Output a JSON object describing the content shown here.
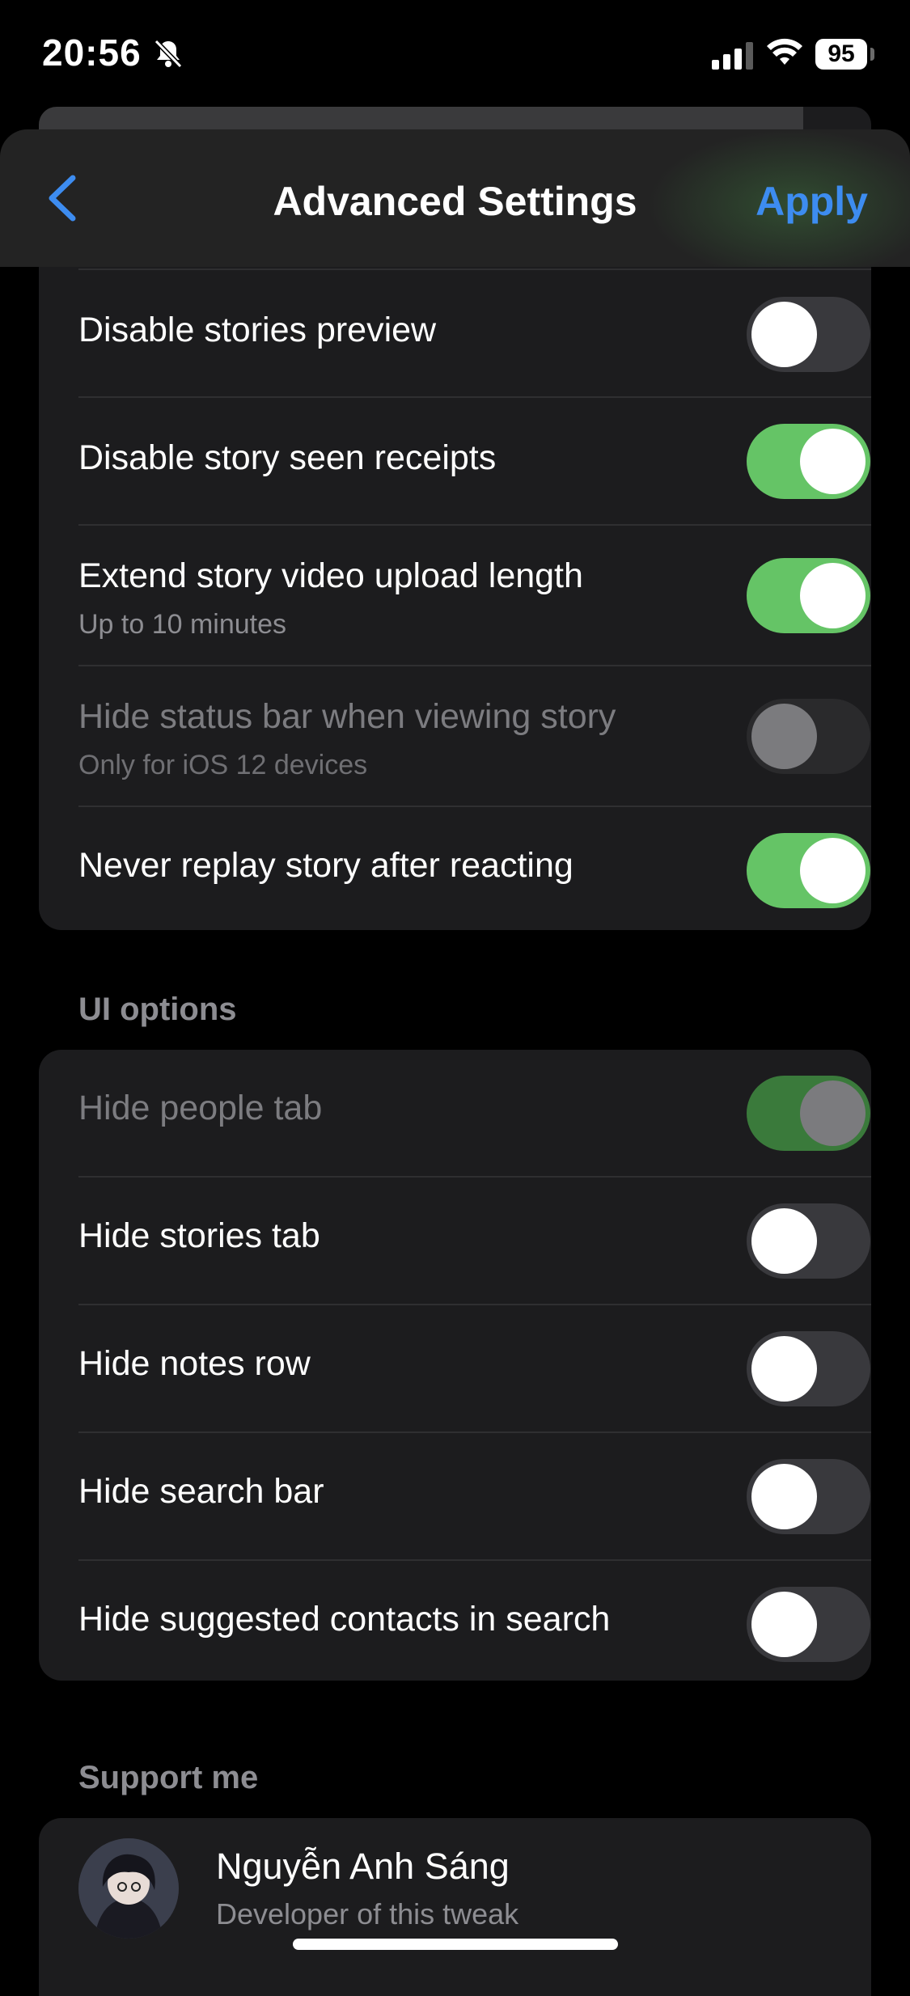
{
  "status_bar": {
    "time": "20:56",
    "battery": "95"
  },
  "nav": {
    "title": "Advanced Settings",
    "apply_label": "Apply"
  },
  "stories_group": {
    "items": [
      {
        "title": "Disable stories preview",
        "subtitle": "",
        "on": false,
        "disabled": false
      },
      {
        "title": "Disable story seen receipts",
        "subtitle": "",
        "on": true,
        "disabled": false
      },
      {
        "title": "Extend story video upload length",
        "subtitle": "Up to 10 minutes",
        "on": true,
        "disabled": false
      },
      {
        "title": "Hide status bar when viewing story",
        "subtitle": "Only for iOS 12 devices",
        "on": false,
        "disabled": true
      },
      {
        "title": "Never replay story after reacting",
        "subtitle": "",
        "on": true,
        "disabled": false
      }
    ]
  },
  "ui_options": {
    "header": "UI options",
    "items": [
      {
        "title": "Hide people tab",
        "on": true,
        "disabled": true
      },
      {
        "title": "Hide stories tab",
        "on": false,
        "disabled": false
      },
      {
        "title": "Hide notes row",
        "on": false,
        "disabled": false
      },
      {
        "title": "Hide search bar",
        "on": false,
        "disabled": false
      },
      {
        "title": "Hide suggested contacts in search",
        "on": false,
        "disabled": false
      }
    ]
  },
  "support": {
    "header": "Support me",
    "developer_name": "Nguyễn Anh Sáng",
    "developer_subtitle": "Developer of this tweak"
  },
  "colors": {
    "accent": "#3d8cf0",
    "toggle_on": "#65c466",
    "background": "#000000",
    "group_bg": "#1c1c1e"
  }
}
